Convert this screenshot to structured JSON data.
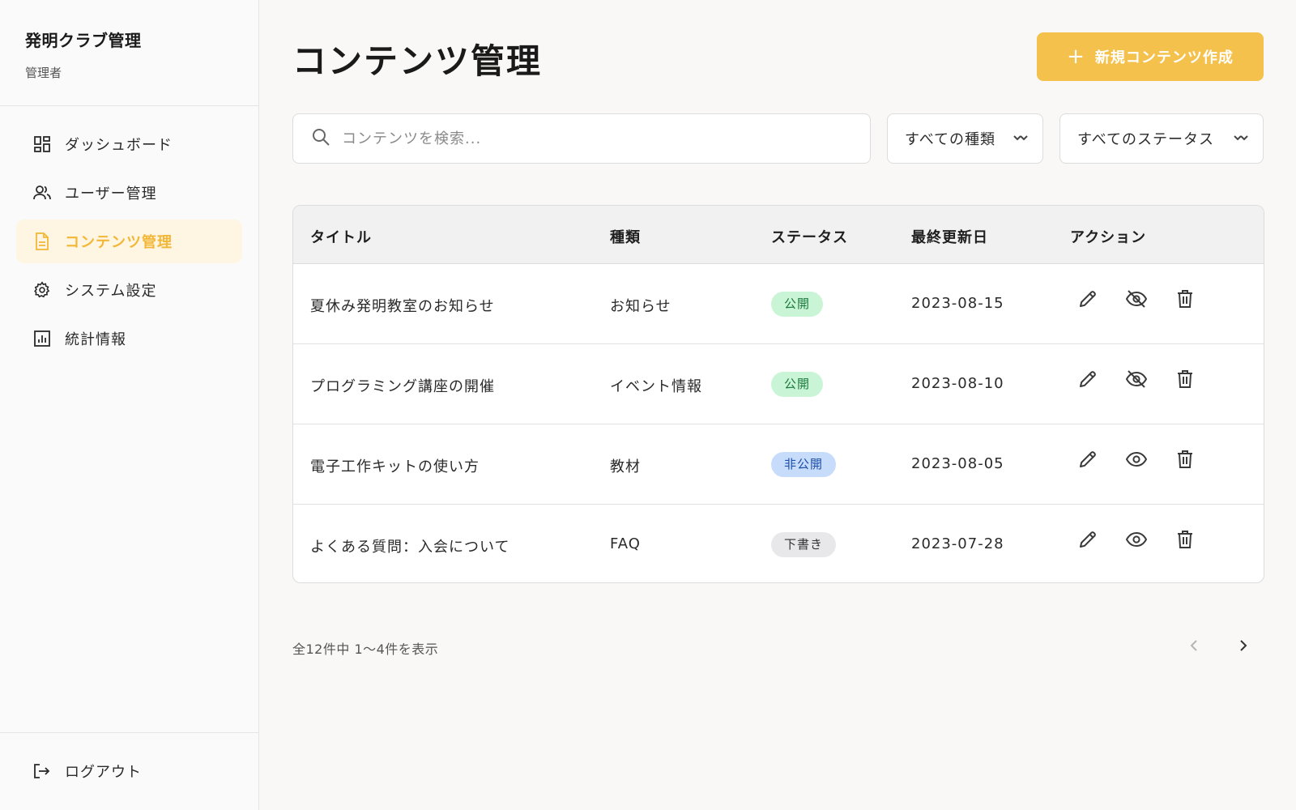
{
  "sidebar": {
    "title": "発明クラブ管理",
    "role": "管理者",
    "items": [
      {
        "label": "ダッシュボード",
        "icon": "dashboard-icon"
      },
      {
        "label": "ユーザー管理",
        "icon": "users-icon"
      },
      {
        "label": "コンテンツ管理",
        "icon": "document-icon",
        "active": true
      },
      {
        "label": "システム設定",
        "icon": "gear-icon"
      },
      {
        "label": "統計情報",
        "icon": "chart-icon"
      }
    ],
    "logout_label": "ログアウト"
  },
  "header": {
    "title": "コンテンツ管理",
    "new_button_label": "新規コンテンツ作成"
  },
  "filters": {
    "search_placeholder": "コンテンツを検索...",
    "type_select": "すべての種類",
    "status_select": "すべてのステータス"
  },
  "table": {
    "columns": [
      "タイトル",
      "種類",
      "ステータス",
      "最終更新日",
      "アクション"
    ],
    "rows": [
      {
        "title": "夏休み発明教室のお知らせ",
        "type": "お知らせ",
        "status": "公開",
        "updated": "2023-08-15",
        "visibility_icon": "eye-off-icon"
      },
      {
        "title": "プログラミング講座の開催",
        "type": "イベント情報",
        "status": "公開",
        "updated": "2023-08-10",
        "visibility_icon": "eye-off-icon"
      },
      {
        "title": "電子工作キットの使い方",
        "type": "教材",
        "status": "非公開",
        "updated": "2023-08-05",
        "visibility_icon": "eye-icon"
      },
      {
        "title": "よくある質問：入会について",
        "type": "FAQ",
        "status": "下書き",
        "updated": "2023-07-28",
        "visibility_icon": "eye-icon"
      }
    ]
  },
  "pagination": {
    "summary": "全12件中 1〜4件を表示"
  },
  "colors": {
    "accent": "#f4c24c",
    "active_nav_bg": "#fff5e3",
    "active_nav_text": "#f2b736",
    "status_public": "#c9f5d6",
    "status_private": "#c7dcfb",
    "status_draft": "#e8e8ea"
  }
}
